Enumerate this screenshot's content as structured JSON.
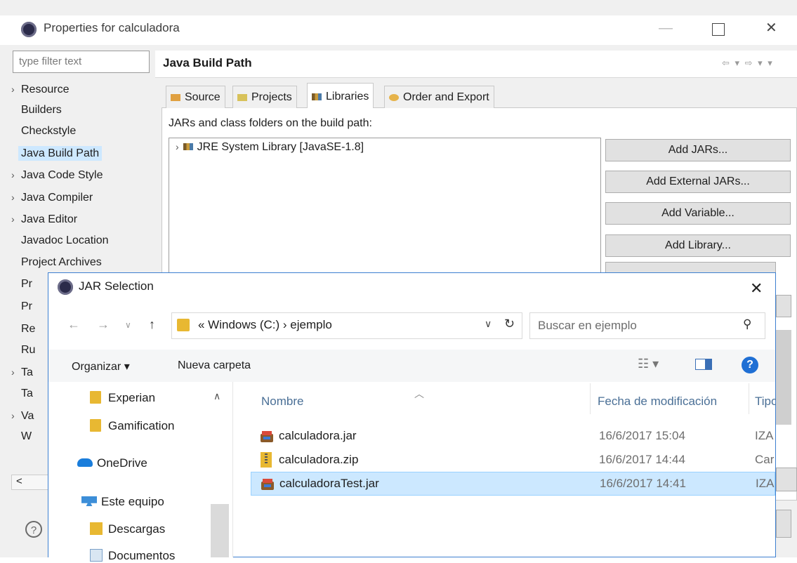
{
  "properties": {
    "title": "Properties for calculadora",
    "filter_placeholder": "type filter text",
    "tree": [
      {
        "label": "Resource",
        "arrow": "›"
      },
      {
        "label": "Builders",
        "arrow": ""
      },
      {
        "label": "Checkstyle",
        "arrow": ""
      },
      {
        "label": "Java Build Path",
        "arrow": ""
      },
      {
        "label": "Java Code Style",
        "arrow": "›"
      },
      {
        "label": "Java Compiler",
        "arrow": "›"
      },
      {
        "label": "Java Editor",
        "arrow": "›"
      },
      {
        "label": "Javadoc Location",
        "arrow": ""
      },
      {
        "label": "Project Archives",
        "arrow": ""
      },
      {
        "label": "Pr",
        "arrow": ""
      },
      {
        "label": "Pr",
        "arrow": ""
      },
      {
        "label": "Re",
        "arrow": ""
      },
      {
        "label": "Ru",
        "arrow": ""
      },
      {
        "label": "Ta",
        "arrow": "›"
      },
      {
        "label": "Ta",
        "arrow": ""
      },
      {
        "label": "Va",
        "arrow": "›"
      },
      {
        "label": "W",
        "arrow": ""
      }
    ],
    "page_title": "Java Build Path",
    "nav_arrows": "⇦ ▾ ⇨ ▾ ▾",
    "tabs": [
      "Source",
      "Projects",
      "Libraries",
      "Order and Export"
    ],
    "list_label": "JARs and class folders on the build path:",
    "jre_entry": "JRE System Library [JavaSE-1.8]",
    "buttons": [
      "Add JARs...",
      "Add External JARs...",
      "Add Variable...",
      "Add Library..."
    ],
    "help_glyph": "?",
    "scroll_left": "<"
  },
  "jar_dialog": {
    "title": "JAR Selection",
    "address": "« Windows (C:) › ejemplo",
    "search_placeholder": "Buscar en ejemplo",
    "organizar": "Organizar ▾",
    "nueva_carpeta": "Nueva carpeta",
    "nav_items": [
      {
        "label": "Experian",
        "icon": "folder-icon"
      },
      {
        "label": "Gamification",
        "icon": "folder-icon"
      },
      {
        "label": "OneDrive",
        "icon": "cloud-icon"
      },
      {
        "label": "Este equipo",
        "icon": "computer-icon"
      },
      {
        "label": "Descargas",
        "icon": "download-icon"
      },
      {
        "label": "Documentos",
        "icon": "document-icon"
      }
    ],
    "columns": {
      "name": "Nombre",
      "date": "Fecha de modificación",
      "type": "Tipo"
    },
    "files": [
      {
        "name": "calculadora.jar",
        "date": "16/6/2017 15:04",
        "type": "IZA",
        "icon": "jar-icon"
      },
      {
        "name": "calculadora.zip",
        "date": "16/6/2017 14:44",
        "type": "Car",
        "icon": "zip-icon"
      },
      {
        "name": "calculadoraTest.jar",
        "date": "16/6/2017 14:41",
        "type": "IZA",
        "icon": "jar-icon",
        "selected": true
      }
    ]
  },
  "colors": {
    "selection": "#cce8ff",
    "accent": "#1f6fd4",
    "dialog_border": "#3d7fd0"
  }
}
